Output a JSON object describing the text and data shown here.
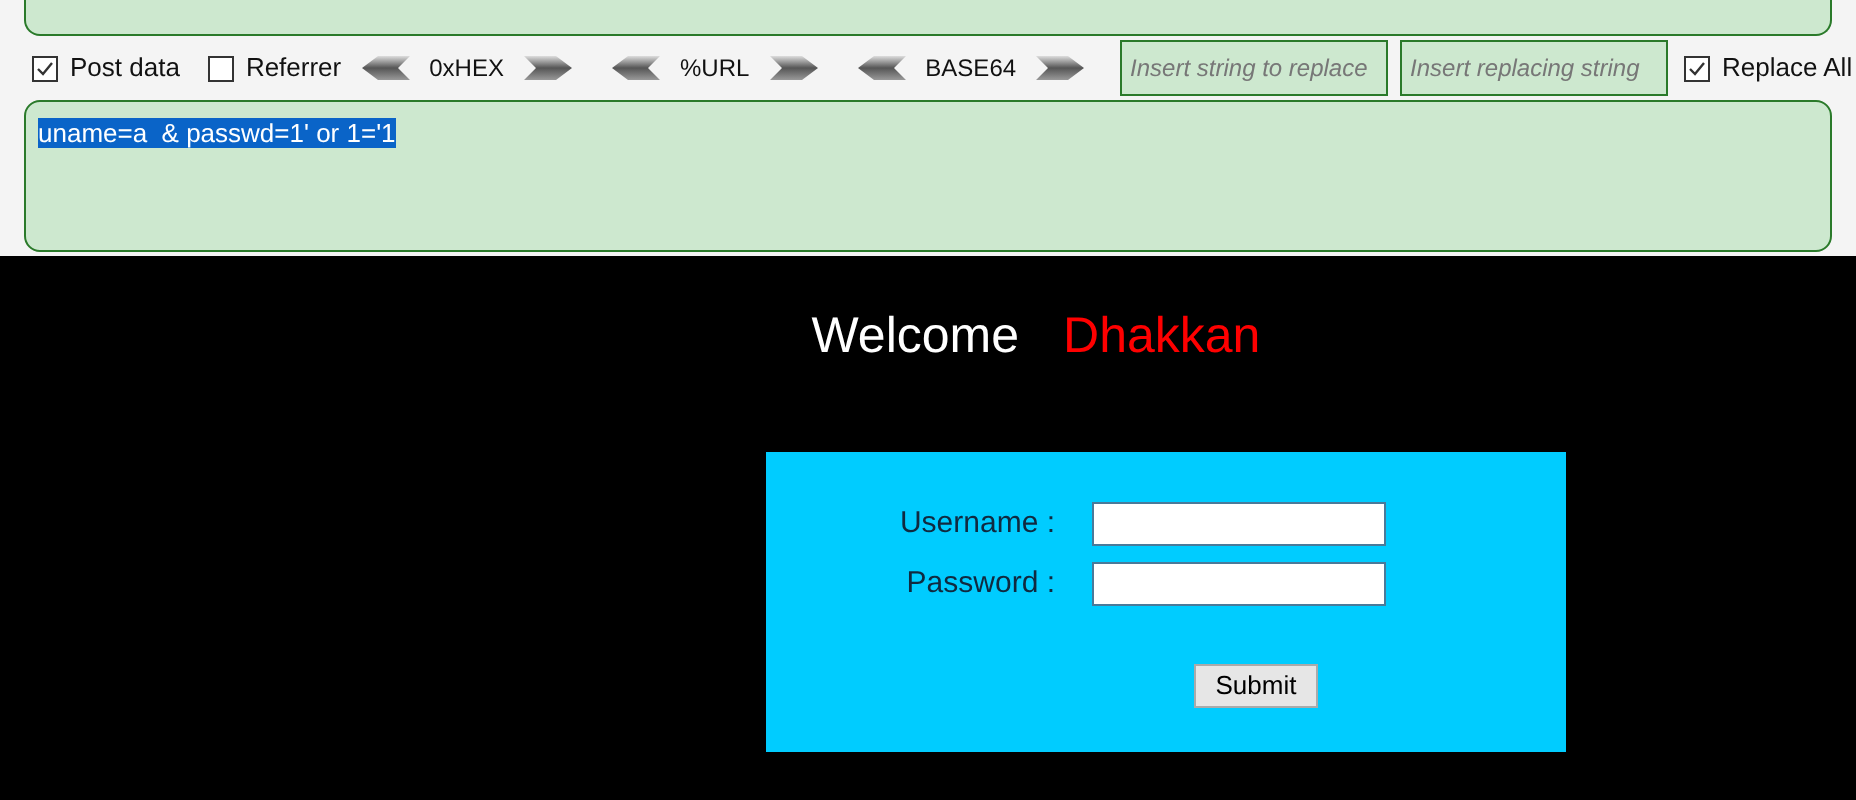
{
  "toolbar": {
    "post_data": {
      "label": "Post data",
      "checked": true
    },
    "referrer": {
      "label": "Referrer",
      "checked": false
    },
    "encoders": [
      {
        "label": "0xHEX"
      },
      {
        "label": "%URL"
      },
      {
        "label": "BASE64"
      }
    ],
    "replace_from": {
      "placeholder": "Insert string to replace"
    },
    "replace_to": {
      "placeholder": "Insert replacing string"
    },
    "replace_all": {
      "label": "Replace All",
      "checked": true
    }
  },
  "post_body": {
    "value": "uname=a  & passwd=1' or 1='1",
    "selected": true
  },
  "page": {
    "welcome": "Welcome",
    "name": "Dhakkan",
    "fields": [
      {
        "label": "Username :"
      },
      {
        "label": "Password :"
      }
    ],
    "submit": "Submit"
  }
}
